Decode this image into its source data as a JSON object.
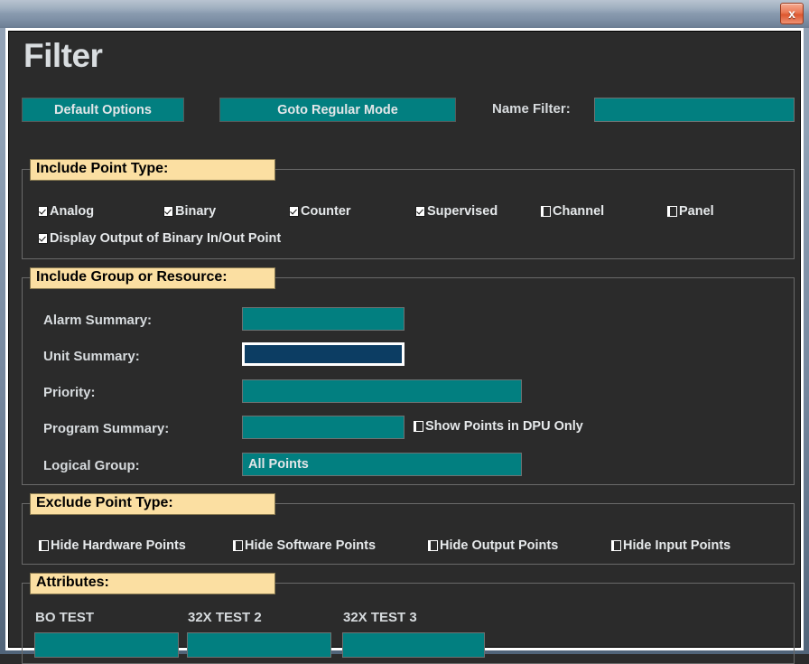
{
  "window": {
    "close_label": "x"
  },
  "page_title": "Filter",
  "toolbar": {
    "default_options_label": "Default Options",
    "goto_regular_mode_label": "Goto Regular Mode",
    "name_filter_label": "Name Filter:",
    "name_filter_value": "",
    "name_filter_placeholder": ""
  },
  "colors": {
    "teal_field": "#027f80",
    "focused_field": "#0c3d63",
    "panel_background": "#2b2b2b",
    "group_title_background": "#fbdfa2",
    "titlebar": "#8fa1b5",
    "close_button": "#dc5730"
  },
  "groups": {
    "include_point_type": {
      "title": "Include Point Type:",
      "checkboxes": [
        {
          "label": "Analog",
          "checked": true
        },
        {
          "label": "Binary",
          "checked": true
        },
        {
          "label": "Counter",
          "checked": true
        },
        {
          "label": "Supervised",
          "checked": true
        },
        {
          "label": "Channel",
          "checked": false
        },
        {
          "label": "Panel",
          "checked": false
        },
        {
          "label": "Display Output of Binary In/Out Point",
          "checked": true
        }
      ]
    },
    "include_group_or_resource": {
      "title": "Include Group or Resource:",
      "rows": [
        {
          "label": "Alarm Summary:",
          "value": "",
          "focused": false
        },
        {
          "label": "Unit Summary:",
          "value": "",
          "focused": true
        },
        {
          "label": "Priority:",
          "value": "",
          "focused": false
        },
        {
          "label": "Program Summary:",
          "value": "",
          "focused": false
        },
        {
          "label": "Logical Group:",
          "value": "All Points",
          "focused": false
        }
      ],
      "dpu_checkbox": {
        "label": "Show Points in DPU Only",
        "checked": false
      }
    },
    "exclude_point_type": {
      "title": "Exclude Point Type:",
      "checkboxes": [
        {
          "label": "Hide Hardware Points",
          "checked": false
        },
        {
          "label": "Hide Software Points",
          "checked": false
        },
        {
          "label": "Hide Output Points",
          "checked": false
        },
        {
          "label": "Hide Input Points",
          "checked": false
        }
      ]
    },
    "attributes": {
      "title": "Attributes:",
      "fields": [
        {
          "label": "BO TEST",
          "value": ""
        },
        {
          "label": "32X TEST 2",
          "value": ""
        },
        {
          "label": "32X TEST 3",
          "value": ""
        }
      ]
    }
  }
}
